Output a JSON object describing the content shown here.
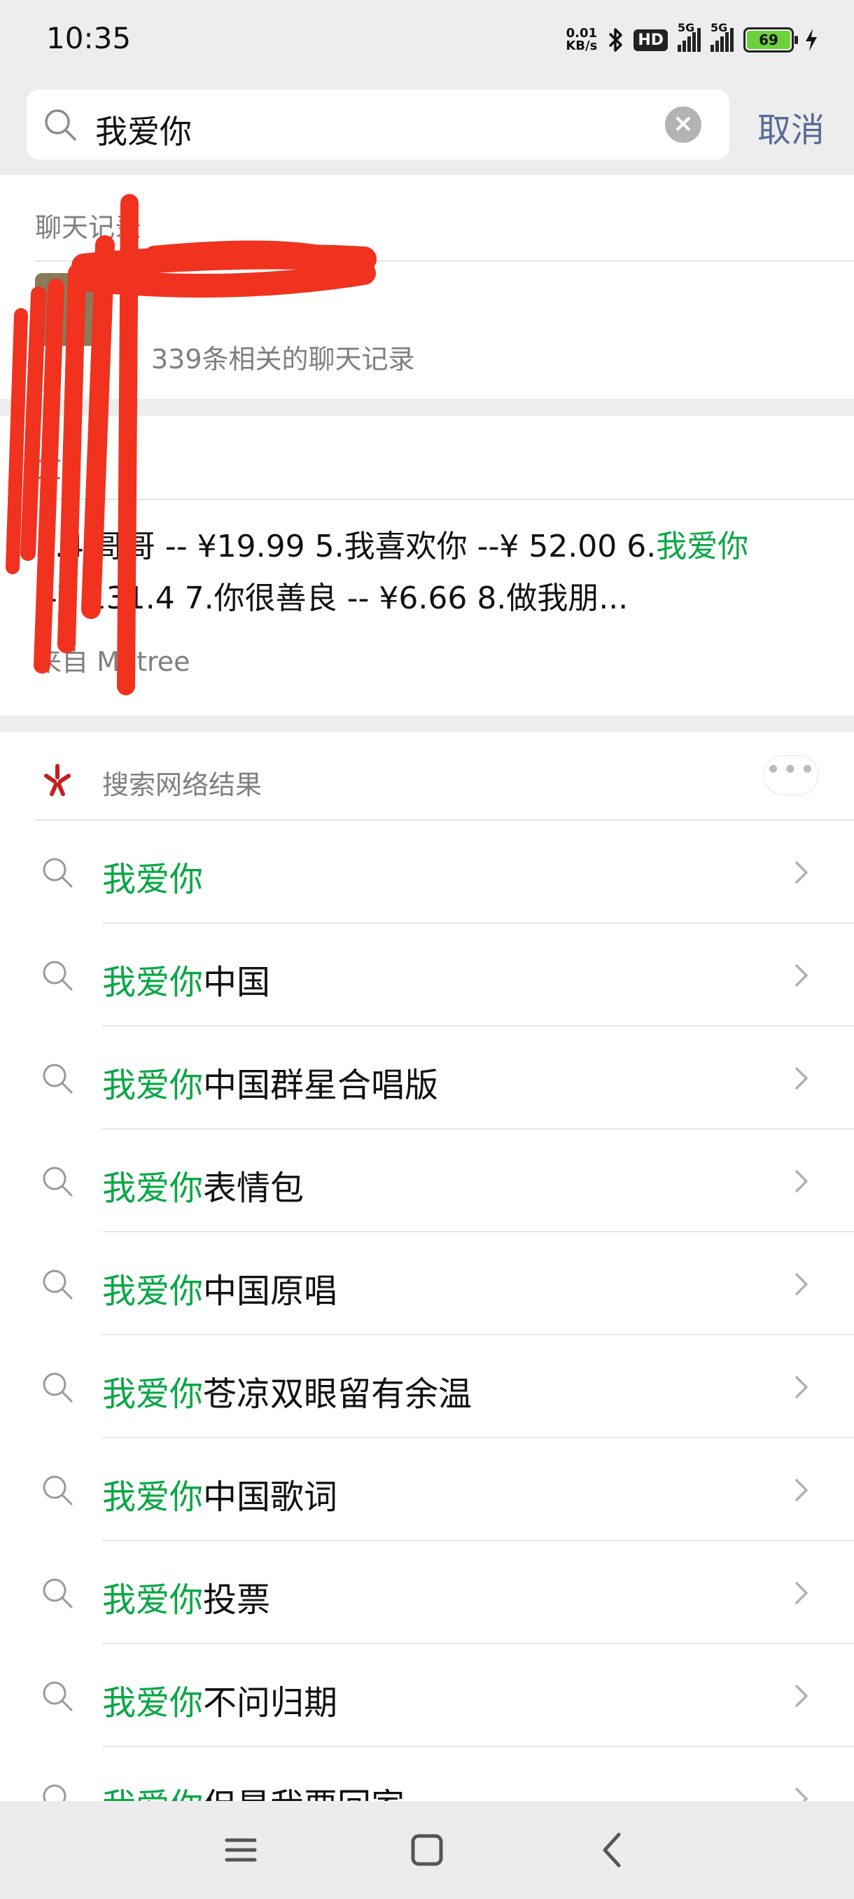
{
  "status_bar": {
    "time": "10:35",
    "net_speed_value": "0.01",
    "net_speed_unit": "KB/s",
    "hd_label": "HD",
    "signal1_label": "5G",
    "signal2_label": "5G",
    "battery_level": "69",
    "icons": [
      "bluetooth-icon",
      "signal-icon",
      "battery-icon",
      "charging-icon"
    ]
  },
  "search": {
    "query": "我爱你",
    "cancel_label": "取消"
  },
  "chat_records": {
    "header": "聊天记录",
    "contact_name": "",
    "count_text": "339条相关的聊天记录"
  },
  "article": {
    "header": "文",
    "line1_pre": "...4.哥哥 -- ¥19.99 5.我喜欢你 --¥ 52.00 6.",
    "line1_hl": "我爱你",
    "line2": "--¥ 131.4 7.你很善良 -- ¥6.66 8.做我朋...",
    "source": "来自 Mr.tree"
  },
  "web_results": {
    "header": "搜索网络结果",
    "more_label": "•••",
    "highlight": "我爱你",
    "items": [
      {
        "hl": "我爱你",
        "rest": ""
      },
      {
        "hl": "我爱你",
        "rest": "中国"
      },
      {
        "hl": "我爱你",
        "rest": "中国群星合唱版"
      },
      {
        "hl": "我爱你",
        "rest": "表情包"
      },
      {
        "hl": "我爱你",
        "rest": "中国原唱"
      },
      {
        "hl": "我爱你",
        "rest": "苍凉双眼留有余温"
      },
      {
        "hl": "我爱你",
        "rest": "中国歌词"
      },
      {
        "hl": "我爱你",
        "rest": "投票"
      },
      {
        "hl": "我爱你",
        "rest": "不问归期"
      },
      {
        "hl": "我爱你",
        "rest": "但是我要回家"
      }
    ]
  },
  "colors": {
    "highlight": "#07a744",
    "cancel": "#576b95",
    "scribble": "#f0321e"
  }
}
